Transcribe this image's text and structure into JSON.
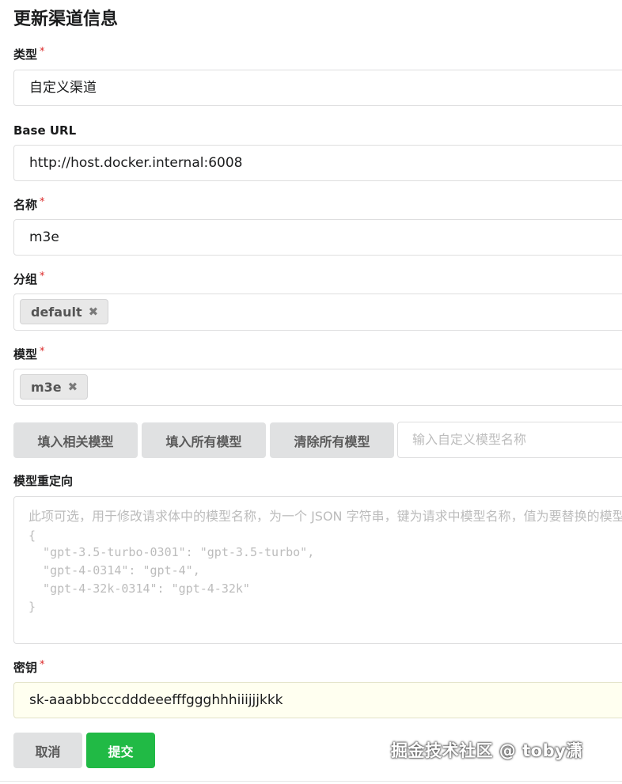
{
  "page": {
    "title": "更新渠道信息"
  },
  "required_mark": "*",
  "type_field": {
    "label": "类型",
    "value": "自定义渠道"
  },
  "base_url_field": {
    "label": "Base URL",
    "value": "http://host.docker.internal:6008"
  },
  "name_field": {
    "label": "名称",
    "value": "m3e"
  },
  "group_field": {
    "label": "分组",
    "chips": [
      {
        "label": "default",
        "close_glyph": "✖"
      }
    ]
  },
  "model_field": {
    "label": "模型",
    "chips": [
      {
        "label": "m3e",
        "close_glyph": "✖"
      }
    ]
  },
  "model_buttons": {
    "fill_related": "填入相关模型",
    "fill_all": "填入所有模型",
    "clear_all": "清除所有模型",
    "custom_placeholder": "输入自定义模型名称"
  },
  "model_mapping_field": {
    "label": "模型重定向",
    "placeholder_lines": [
      "此项可选，用于修改请求体中的模型名称，为一个 JSON 字符串，键为请求中模型名称，值为要替换的模型名称，例如：",
      "{",
      "  \"gpt-3.5-turbo-0301\": \"gpt-3.5-turbo\",",
      "  \"gpt-4-0314\": \"gpt-4\",",
      "  \"gpt-4-32k-0314\": \"gpt-4-32k\"",
      "}"
    ]
  },
  "key_field": {
    "label": "密钥",
    "value": "sk-aaabbbcccdddeeefffggghhhiiijjjkkk"
  },
  "actions": {
    "cancel": "取消",
    "submit": "提交"
  },
  "watermark": "掘金技术社区 @ toby潇",
  "colors": {
    "required": "#db2828",
    "submit_green": "#21ba45",
    "button_grey": "#e0e1e2",
    "secret_bg": "#fffff0"
  },
  "icons": {
    "chip_close": "close-icon"
  }
}
